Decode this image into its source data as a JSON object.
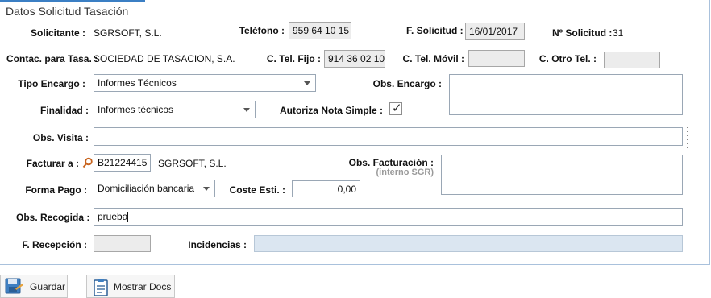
{
  "section_title": "Datos Solicitud Tasación",
  "labels": {
    "solicitante": "Solicitante :",
    "telefono": "Teléfono :",
    "f_solicitud": "F. Solicitud :",
    "n_solicitud": "Nº Solicitud :",
    "contac_tasa": "Contac. para Tasa. :",
    "c_tel_fijo": "C. Tel. Fijo :",
    "c_tel_movil": "C. Tel. Móvil :",
    "c_otro_tel": "C. Otro Tel. :",
    "tipo_encargo": "Tipo Encargo :",
    "obs_encargo": "Obs. Encargo :",
    "finalidad": "Finalidad :",
    "autoriza_nota": "Autoriza Nota Simple :",
    "obs_visita": "Obs. Visita :",
    "facturar_a": "Facturar a :",
    "obs_facturacion": "Obs. Facturación :",
    "interno_sgr": "(interno SGR)",
    "forma_pago": "Forma Pago :",
    "coste_esti": "Coste Esti. :",
    "obs_recogida": "Obs. Recogida :",
    "f_recepcion": "F. Recepción :",
    "incidencias": "Incidencias :"
  },
  "values": {
    "solicitante": "SGRSOFT, S.L.",
    "telefono": "959 64 10 15",
    "f_solicitud": "16/01/2017",
    "n_solicitud": "31",
    "contac_tasa": "SOCIEDAD DE TASACION, S.A.",
    "c_tel_fijo": "914 36 02 10",
    "c_tel_movil": "",
    "c_otro_tel": "",
    "tipo_encargo": "Informes Técnicos",
    "obs_encargo": "",
    "finalidad": "Informes técnicos",
    "autoriza_nota_checked": true,
    "obs_visita": "",
    "facturar_a_code": "B21224415",
    "facturar_a_name": "SGRSOFT, S.L.",
    "obs_facturacion": "",
    "forma_pago": "Domiciliación bancaria",
    "coste_esti": "0,00",
    "obs_recogida": "prueba",
    "f_recepcion": "",
    "incidencias": ""
  },
  "buttons": {
    "guardar": "Guardar",
    "mostrar_docs": "Mostrar Docs"
  },
  "icons": {
    "checkmark": "check-icon",
    "search": "search-icon",
    "save": "save-icon",
    "docs": "clipboard-icon"
  }
}
